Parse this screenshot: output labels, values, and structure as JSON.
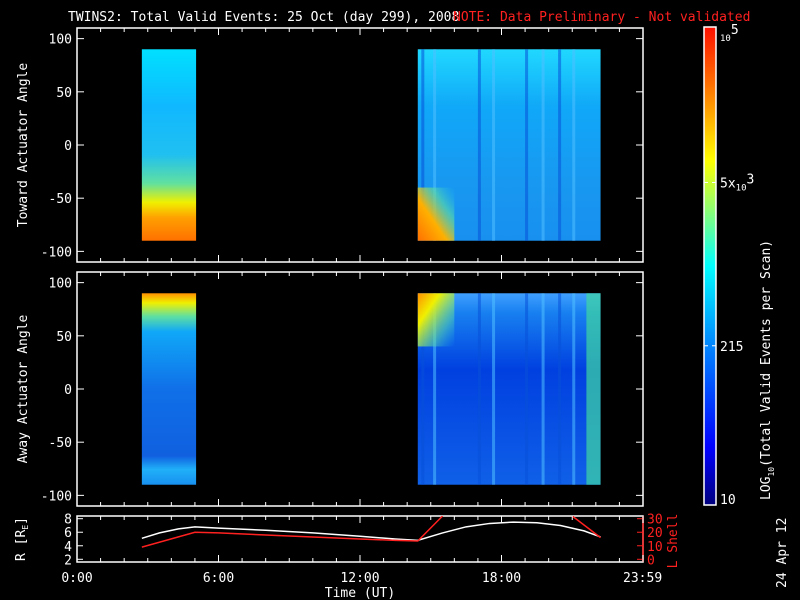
{
  "title": "TWINS2: Total Valid Events: 25 Oct (day 299), 2008",
  "note": "NOTE: Data Preliminary - Not validated",
  "date_stamp": "24 Apr 12",
  "colors": {
    "note": "#ff2020",
    "r_line": "#ffffff",
    "l_line": "#ff2020",
    "axis": "#ffffff"
  },
  "chart_data": [
    {
      "type": "heatmap",
      "name": "toward",
      "ylabel": "Toward Actuator Angle",
      "ylim": [
        -110,
        110
      ],
      "yticks": [
        -100,
        -50,
        0,
        50,
        100
      ],
      "xlim": [
        0,
        24
      ],
      "data_intervals_hours": [
        [
          2.75,
          5.05
        ],
        [
          14.45,
          22.2
        ]
      ],
      "angle_range": [
        -90,
        90
      ],
      "description_profile": [
        {
          "interval": 0,
          "angle_counts": [
            [
              90,
              300
            ],
            [
              40,
              230
            ],
            [
              0,
              260
            ],
            [
              -40,
              700
            ],
            [
              -60,
              6000
            ],
            [
              -80,
              30000
            ]
          ]
        },
        {
          "interval": 1,
          "angle_counts": [
            [
              90,
              450
            ],
            [
              40,
              280
            ],
            [
              0,
              250
            ],
            [
              -40,
              230
            ],
            [
              -80,
              220
            ]
          ]
        }
      ],
      "stripe_hours": [
        14.6,
        15.1,
        17.0,
        17.6,
        19.0,
        19.7,
        20.4,
        21.0
      ]
    },
    {
      "type": "heatmap",
      "name": "away",
      "ylabel": "Away Actuator Angle",
      "ylim": [
        -110,
        110
      ],
      "yticks": [
        -100,
        -50,
        0,
        50,
        100
      ],
      "xlim": [
        0,
        24
      ],
      "data_intervals_hours": [
        [
          2.75,
          5.05
        ],
        [
          14.45,
          22.2
        ]
      ],
      "angle_range": [
        -90,
        90
      ],
      "description_profile": [
        {
          "interval": 0,
          "angle_counts": [
            [
              90,
              20000
            ],
            [
              75,
              2000
            ],
            [
              60,
              600
            ],
            [
              30,
              200
            ],
            [
              0,
              150
            ],
            [
              -50,
              120
            ],
            [
              -80,
              300
            ]
          ]
        },
        {
          "interval": 1,
          "angle_counts": [
            [
              90,
              600
            ],
            [
              60,
              200
            ],
            [
              0,
              80
            ],
            [
              -50,
              100
            ],
            [
              -90,
              150
            ]
          ]
        }
      ],
      "stripe_hours": [
        14.6,
        15.1,
        17.0,
        17.6,
        19.0,
        19.7,
        20.4,
        21.0
      ]
    },
    {
      "type": "line",
      "name": "orbit",
      "ylabel": "R [R_E]",
      "ylabel_main": "R [R",
      "ylabel_sub": "E",
      "ylabel_close": "]",
      "y2label": "L Shell",
      "ylim": [
        1.6,
        8.4
      ],
      "yticks": [
        2,
        4,
        6,
        8
      ],
      "y2lim": [
        -2,
        32
      ],
      "y2ticks": [
        0,
        10,
        20,
        30
      ],
      "series": [
        {
          "name": "R",
          "x": [
            2.75,
            3.5,
            4.3,
            5.0,
            6.0,
            8.0,
            10.0,
            12.0,
            13.5,
            14.45,
            15.5,
            16.5,
            17.5,
            18.5,
            19.5,
            20.5,
            21.5,
            22.2
          ],
          "y": [
            5.1,
            5.9,
            6.5,
            6.8,
            6.6,
            6.3,
            5.9,
            5.4,
            5.0,
            4.8,
            5.9,
            6.8,
            7.3,
            7.5,
            7.4,
            7.0,
            6.2,
            5.3
          ]
        },
        {
          "name": "L Shell",
          "x": [
            2.75,
            5.0,
            6.0,
            8.0,
            10.0,
            12.0,
            13.5,
            14.45,
            15.5,
            null,
            21.0,
            22.2
          ],
          "y": [
            9,
            20,
            19.5,
            18,
            16.5,
            15,
            14,
            13.5,
            32,
            null,
            32,
            16
          ]
        }
      ]
    },
    {
      "type": "colorbar",
      "label_main": "LOG",
      "label_sub": "10",
      "label_rest": "(Total Valid Events per Scan)",
      "scale": "log",
      "range": [
        10,
        100000
      ],
      "ticks": [
        {
          "value": 10,
          "label": "10"
        },
        {
          "value": 215,
          "label": "215"
        },
        {
          "value": 5000,
          "label": "5x10",
          "sup": "3"
        },
        {
          "value": 100000,
          "label": "10",
          "sup": "5"
        }
      ]
    }
  ],
  "xaxis": {
    "label": "Time (UT)",
    "ticks": [
      {
        "value": 0,
        "label": "0:00"
      },
      {
        "value": 6,
        "label": "6:00"
      },
      {
        "value": 12,
        "label": "12:00"
      },
      {
        "value": 18,
        "label": "18:00"
      },
      {
        "value": 23.983,
        "label": "23:59"
      }
    ]
  }
}
